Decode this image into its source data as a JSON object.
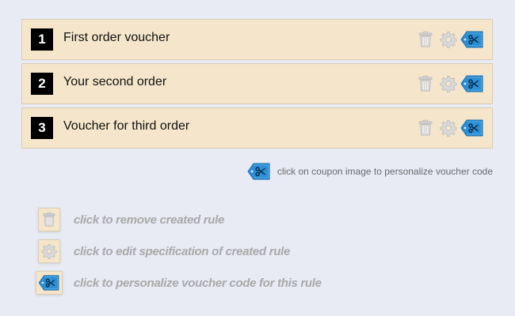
{
  "rules": [
    {
      "number": "1",
      "title": "First order voucher"
    },
    {
      "number": "2",
      "title": "Your second order"
    },
    {
      "number": "3",
      "title": "Voucher for third order"
    }
  ],
  "hint": {
    "text": "click on coupon image to personalize voucher code",
    "icon": "coupon-scissors-icon"
  },
  "legend": {
    "remove": {
      "icon": "trash-icon",
      "text": "click to remove created rule"
    },
    "edit": {
      "icon": "gear-icon",
      "text": "click to edit specification of created rule"
    },
    "personalize": {
      "icon": "coupon-scissors-icon",
      "text": "click to personalize voucher code for this rule"
    }
  },
  "colors": {
    "background": "#e8eaf4",
    "rule_background": "#f5e6cb",
    "coupon_blue": "#2a8fd6",
    "legend_text": "#a9a9a9"
  }
}
